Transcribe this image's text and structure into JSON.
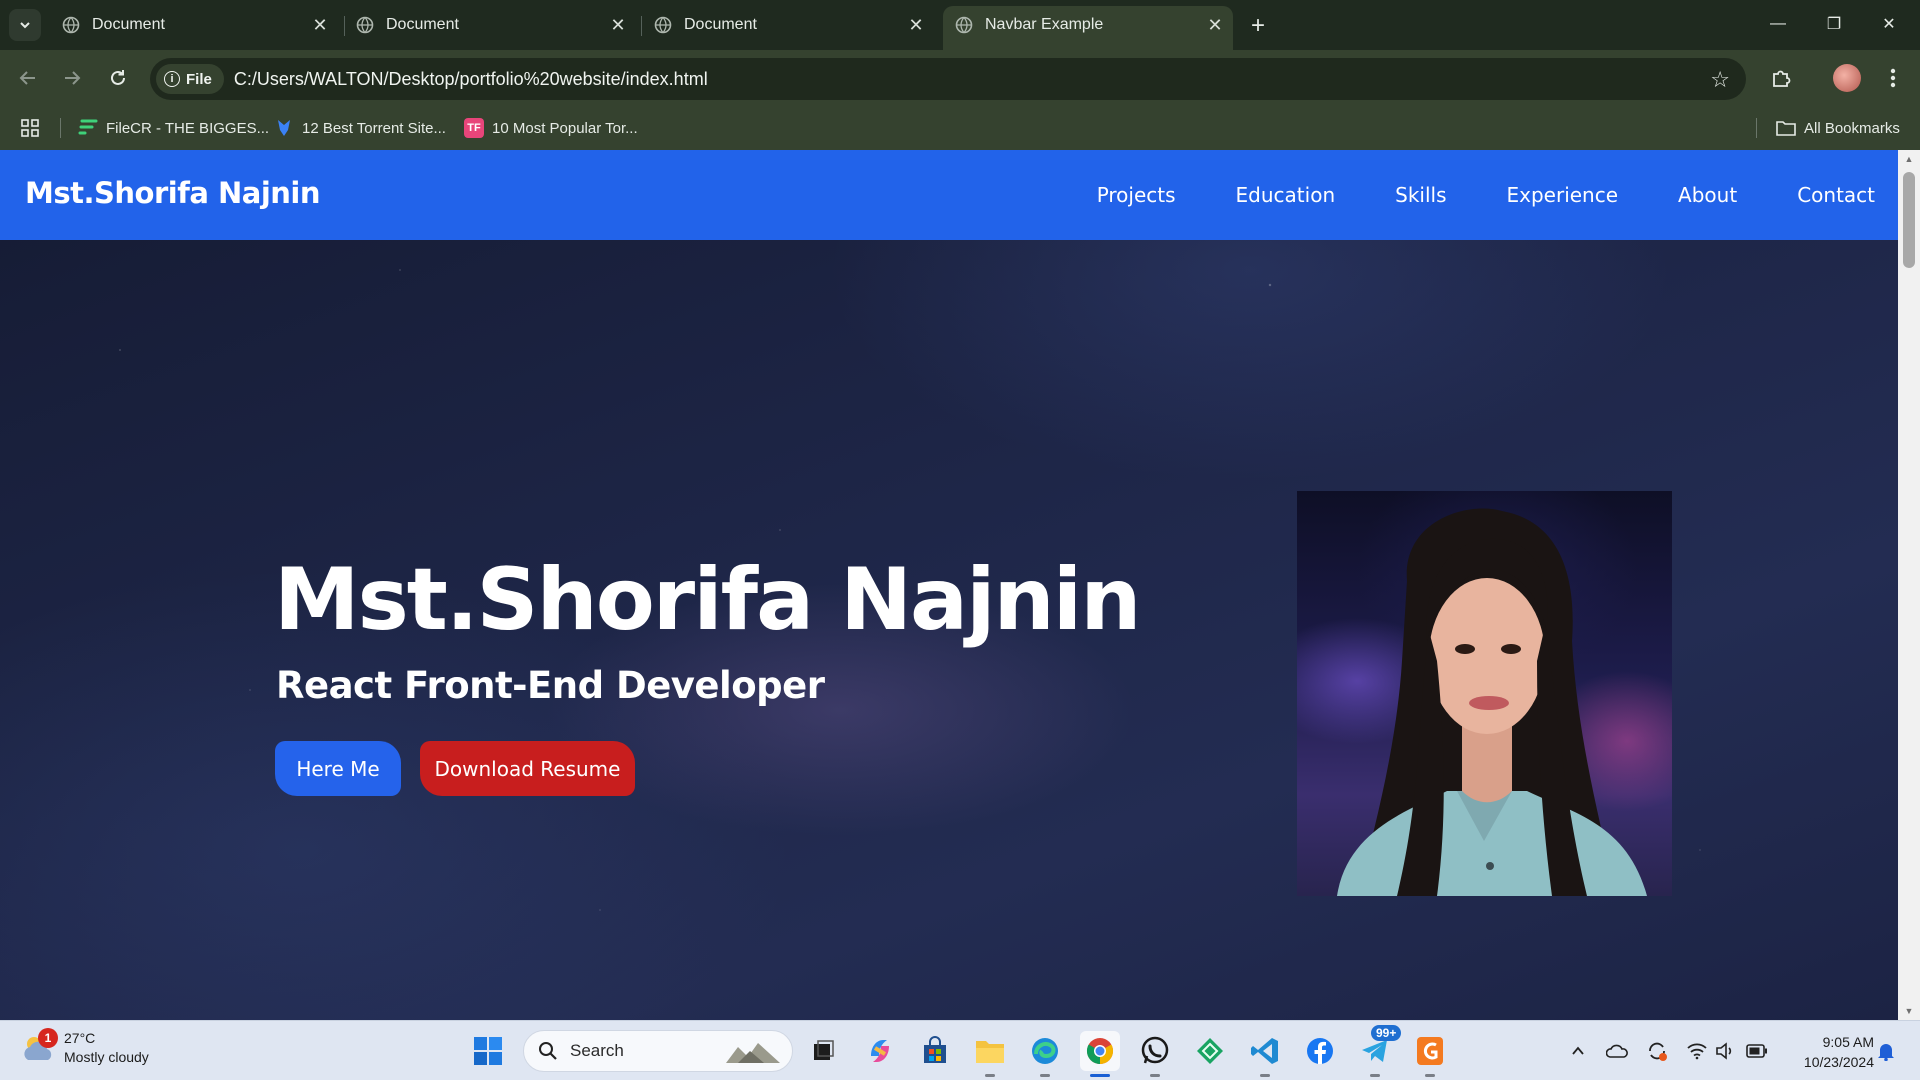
{
  "browser": {
    "tabs": [
      {
        "title": "Document",
        "active": false
      },
      {
        "title": "Document",
        "active": false
      },
      {
        "title": "Document",
        "active": false
      },
      {
        "title": "Navbar Example",
        "active": true
      }
    ],
    "address": {
      "scheme_chip": "File",
      "url": "C:/Users/WALTON/Desktop/portfolio%20website/index.html"
    },
    "bookmarks": [
      {
        "label": "FileCR - THE BIGGES..."
      },
      {
        "label": "12 Best Torrent Site..."
      },
      {
        "label": "10 Most Popular Tor...",
        "icon_text": "TF"
      }
    ],
    "all_bookmarks_label": "All Bookmarks"
  },
  "site": {
    "brand": "Mst.Shorifa Najnin",
    "nav": [
      "Projects",
      "Education",
      "Skills",
      "Experience",
      "About",
      "Contact"
    ],
    "hero": {
      "name": "Mst.Shorifa Najnin",
      "role": "React Front-End Developer",
      "primary_button": "Here Me",
      "secondary_button": "Download Resume"
    },
    "colors": {
      "navbar": "#2263ea",
      "primary_button": "#2563eb",
      "secondary_button": "#c81e1e"
    }
  },
  "taskbar": {
    "weather": {
      "temp": "27°C",
      "condition": "Mostly cloudy",
      "badge": "1"
    },
    "search_placeholder": "Search",
    "apps": [
      "start",
      "search",
      "task-view",
      "copilot",
      "store",
      "file-explorer",
      "edge",
      "chrome",
      "whatsapp",
      "app-green",
      "vscode",
      "facebook",
      "telegram",
      "pdf-app"
    ],
    "telegram_badge": "99+",
    "clock": {
      "time": "9:05 AM",
      "date": "10/23/2024"
    }
  }
}
